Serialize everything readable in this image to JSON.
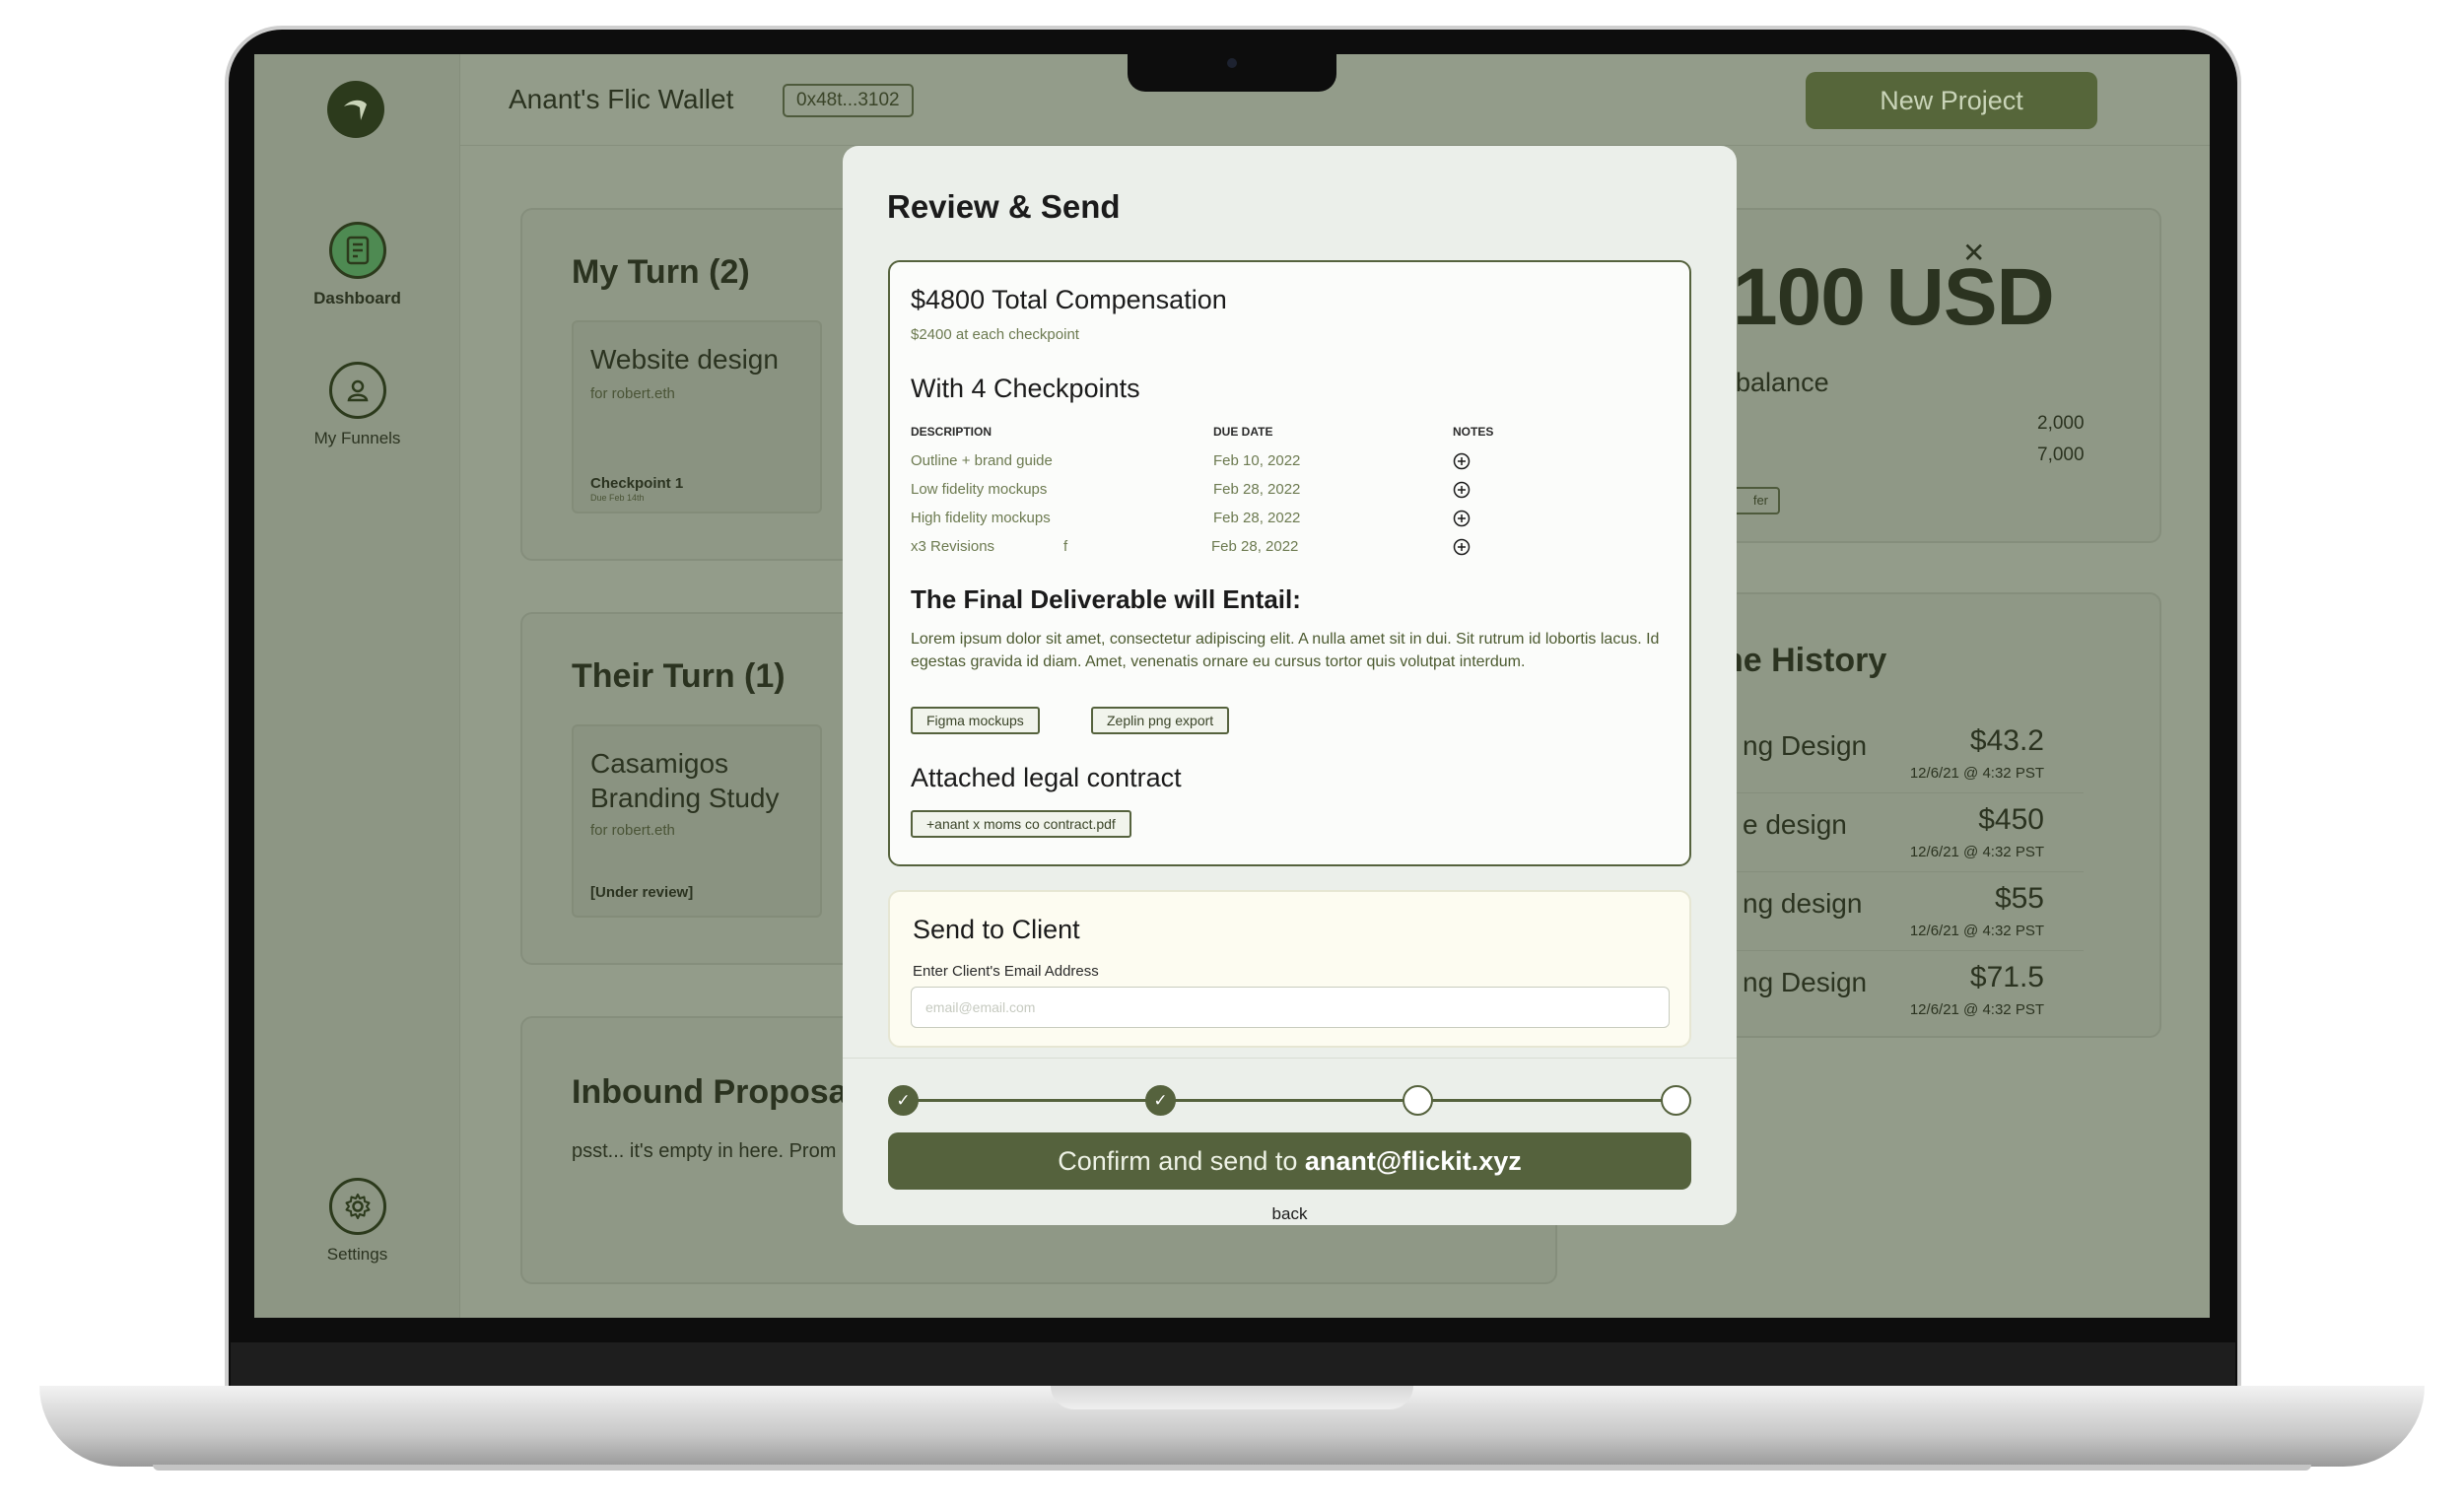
{
  "header": {
    "wallet_title": "Anant's Flic Wallet",
    "wallet_address": "0x48t...3102",
    "new_project_label": "New Project"
  },
  "sidebar": {
    "items": [
      {
        "label": "Dashboard",
        "icon": "document-icon",
        "active": true
      },
      {
        "label": "My Funnels",
        "icon": "user-icon",
        "active": false
      },
      {
        "label": "Settings",
        "icon": "gear-icon",
        "active": false
      }
    ]
  },
  "my_turn": {
    "title": "My Turn (2)",
    "card": {
      "title": "Website design",
      "subtitle": "for robert.eth",
      "checkpoint": "Checkpoint 1",
      "due": "Due Feb 14th"
    }
  },
  "their_turn": {
    "title": "Their Turn (1)",
    "card": {
      "title_line1": "Casamigos",
      "title_line2": "Branding Study",
      "subtitle": "for robert.eth",
      "status": "[Under review]"
    }
  },
  "inbound": {
    "title": "Inbound Proposa",
    "subtitle": "psst... it's empty in here. Prom"
  },
  "balance": {
    "amount": "100 USD",
    "label": "balance",
    "values": [
      "2,000",
      "7,000"
    ],
    "button_label": "fer"
  },
  "history": {
    "title": "ne History",
    "rows": [
      {
        "name": "ng Design",
        "amount": "$43.2",
        "date": "12/6/21 @ 4:32 PST"
      },
      {
        "name": "e design",
        "amount": "$450",
        "date": "12/6/21 @ 4:32 PST"
      },
      {
        "name": "ng design",
        "amount": "$55",
        "date": "12/6/21 @ 4:32 PST"
      },
      {
        "name": "ng Design",
        "amount": "$71.5",
        "date": "12/6/21 @ 4:32 PST"
      }
    ]
  },
  "modal": {
    "title": "Review & Send",
    "compensation": "$4800 Total Compensation",
    "compensation_sub": "$2400 at each checkpoint",
    "checkpoints_title": "With 4 Checkpoints",
    "table": {
      "headers": [
        "DESCRIPTION",
        "DUE DATE",
        "NOTES"
      ],
      "rows": [
        {
          "description": "Outline + brand guide",
          "extra": "",
          "due": "Feb 10, 2022"
        },
        {
          "description": "Low fidelity mockups",
          "extra": "",
          "due": "Feb 28, 2022"
        },
        {
          "description": "High fidelity mockups",
          "extra": "",
          "due": "Feb 28, 2022"
        },
        {
          "description": "x3 Revisions",
          "extra": "f",
          "due": "Feb 28, 2022"
        }
      ]
    },
    "deliverable_title": "The Final Deliverable will Entail:",
    "deliverable_text": "Lorem ipsum dolor sit amet, consectetur adipiscing elit. A nulla amet sit in dui. Sit rutrum id lobortis lacus. Id egestas gravida id diam. Amet, venenatis ornare eu cursus tortor quis volutpat interdum.",
    "deliverable_tags": [
      "Figma mockups",
      "Zeplin png export"
    ],
    "contract_title": "Attached legal contract",
    "contract_file": "+anant x moms co contract.pdf",
    "send": {
      "title": "Send to Client",
      "label": "Enter Client's Email Address",
      "value": "",
      "placeholder": "email@email.com"
    },
    "steps": [
      "done",
      "done",
      "todo",
      "todo"
    ],
    "confirm_prefix": "Confirm and send to ",
    "confirm_email": "anant@flickit.xyz",
    "back_label": "back"
  },
  "colors": {
    "accent": "#55623d",
    "background_dim": "#939c8a",
    "modal_bg": "#ebefea"
  }
}
